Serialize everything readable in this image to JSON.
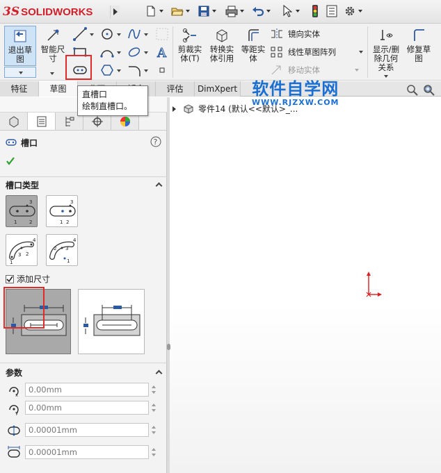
{
  "app": {
    "logo_ds": "3S",
    "logo_text": "SOLIDWORKS"
  },
  "ribbon": {
    "exit_sketch": "退出草图",
    "smart_dimension": "智能尺寸",
    "trim_entities": "剪裁实体(T)",
    "convert_entities": "转换实体引用",
    "offset_entities": "等距实体",
    "mirror_entities": "镜向实体",
    "linear_pattern": "线性草图阵列",
    "move_entities": "移动实体",
    "display_delete_relations": "显示/删除几何关系",
    "repair_sketch": "修复草图"
  },
  "tabs": [
    {
      "label": "特征"
    },
    {
      "label": "草图"
    },
    {
      "label": "曲面"
    },
    {
      "label": "钣金"
    },
    {
      "label": "评估"
    },
    {
      "label": "DimXpert"
    }
  ],
  "tooltip": {
    "title": "直槽口",
    "description": "绘制直槽口。"
  },
  "watermark": {
    "title": "软件自学网",
    "url": "WWW.RJZXW.COM"
  },
  "tree": {
    "part_label": "零件14  (默认<<默认>_..."
  },
  "property_manager": {
    "title": "槽口",
    "slot_type_header": "槽口类型",
    "add_dimensions_label": "添加尺寸",
    "add_dimensions_checked": true,
    "params_header": "参数",
    "params": [
      {
        "icon": "center-x-icon",
        "value": "0.00mm"
      },
      {
        "icon": "center-y-icon",
        "value": "0.00mm"
      },
      {
        "icon": "slot-width-icon",
        "value": "0.00001mm"
      },
      {
        "icon": "slot-length-icon",
        "value": "0.00001mm"
      }
    ],
    "slot_numbers": {
      "one": "1",
      "two": "2",
      "three": "3",
      "four": "4"
    }
  },
  "colors": {
    "highlight_red": "#e12b2b",
    "watermark_blue": "#1a6fd1",
    "brand_red": "#d0202a",
    "origin_red": "#d92020"
  }
}
